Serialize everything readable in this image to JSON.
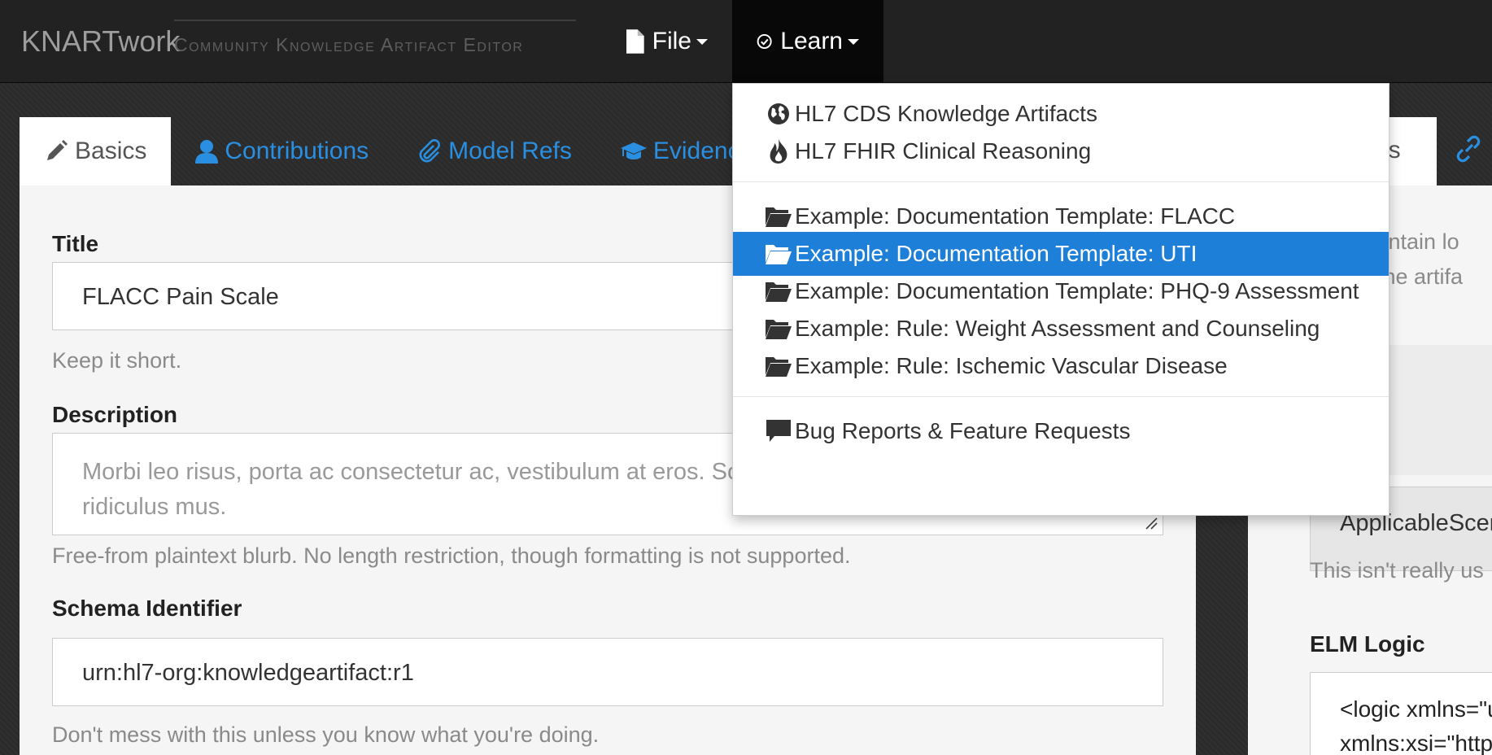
{
  "navbar": {
    "brand": "KNARTwork",
    "brand_subtitle": "Community Knowledge Artifact Editor",
    "file_label": "File",
    "learn_label": "Learn"
  },
  "tabs": [
    {
      "label": "Basics",
      "icon": "pencil-icon"
    },
    {
      "label": "Contributions",
      "icon": "user-icon"
    },
    {
      "label": "Model Refs",
      "icon": "paperclip-icon"
    },
    {
      "label": "Evidence",
      "icon": "graduation-cap-icon"
    }
  ],
  "tab_right_partial": "ns",
  "basics": {
    "title_label": "Title",
    "title_value": "FLACC Pain Scale",
    "title_help": "Keep it short.",
    "description_label": "Description",
    "description_placeholder": "Morbi leo risus, porta ac consectetur ac, vestibulum at eros. Soci parturient montes, nascetur ridiculus mus.",
    "description_help": "Free-from plaintext blurb. No length restriction, though formatting is not supported.",
    "schema_label": "Schema Identifier",
    "schema_value": "urn:hl7-org:knowledgeartifact:r1",
    "schema_help": "Don't mess with this unless you know what you're doing."
  },
  "right_panel": {
    "help_top_line1": "contain lo",
    "help_top_line2": "f the artifa",
    "scenario_value": "ApplicableScen",
    "scenario_help": "This isn't really us",
    "elm_label": "ELM Logic",
    "elm_line1": "<logic xmlns=\"u",
    "elm_line2": "xmlns:xsi=\"http"
  },
  "learn_menu": {
    "items": [
      {
        "label": "HL7 CDS Knowledge Artifacts",
        "icon": "globe-icon"
      },
      {
        "label": "HL7 FHIR Clinical Reasoning",
        "icon": "fire-icon"
      },
      {
        "label": "Example: Documentation Template: FLACC",
        "icon": "folder-open-icon"
      },
      {
        "label": "Example: Documentation Template: UTI",
        "icon": "folder-open-icon",
        "active": true
      },
      {
        "label": "Example: Documentation Template: PHQ-9 Assessment",
        "icon": "folder-open-icon"
      },
      {
        "label": "Example: Rule: Weight Assessment and Counseling",
        "icon": "folder-open-icon"
      },
      {
        "label": "Example: Rule: Ischemic Vascular Disease",
        "icon": "folder-open-icon"
      },
      {
        "label": "Bug Reports & Feature Requests",
        "icon": "comment-icon"
      }
    ]
  },
  "colors": {
    "accent": "#1e7fd8",
    "link": "#2a8fe0",
    "navbar": "#222222"
  }
}
